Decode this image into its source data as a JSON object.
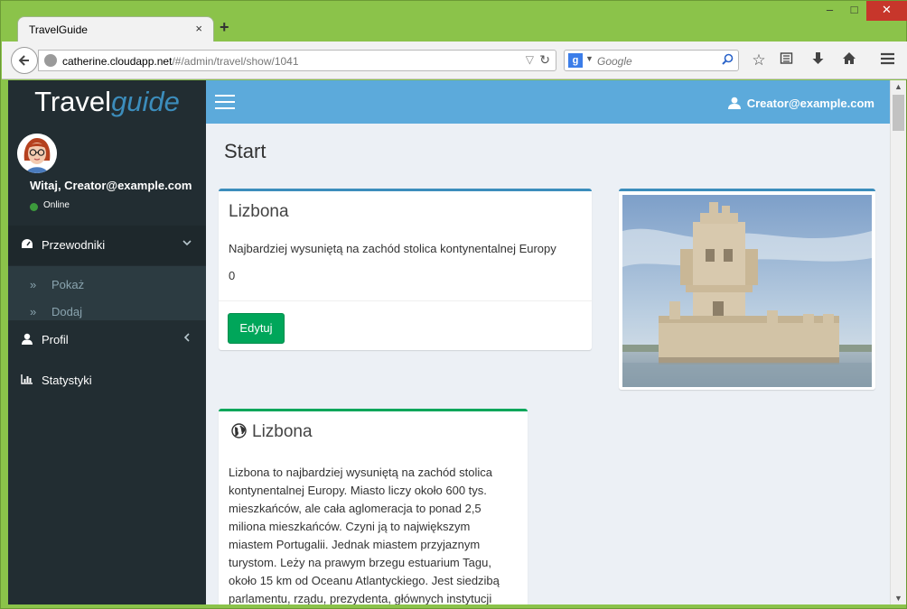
{
  "browser": {
    "tab_title": "TravelGuide",
    "tab_close": "×",
    "new_tab": "+",
    "window_min": "–",
    "window_max": "□",
    "window_close": "✕",
    "url_host": "catherine.cloudapp.net",
    "url_path": "/#/admin/travel/show/1041",
    "search_engine": "g",
    "search_placeholder": "Google"
  },
  "sidebar": {
    "logo_travel": "Travel",
    "logo_guide": "guide",
    "user_greeting": "Witaj, Creator@example.com",
    "status": "Online",
    "menu": [
      {
        "label": "Przewodniki",
        "icon": "dashboard-icon",
        "arrow": "⌄",
        "active": true
      },
      {
        "label": "Profil",
        "icon": "user-icon",
        "arrow": "‹",
        "active": false
      },
      {
        "label": "Statystyki",
        "icon": "bar-chart-icon",
        "arrow": "",
        "active": false
      }
    ],
    "submenu": [
      {
        "label": "Pokaż"
      },
      {
        "label": "Dodaj"
      }
    ]
  },
  "header": {
    "user_email": "Creator@example.com",
    "bg_color": "#5caadb"
  },
  "main": {
    "page_title": "Start",
    "card": {
      "title": "Lizbona",
      "description": "Najbardziej wysuniętą na zachód stolica kontynentalnej Europy",
      "number": "0",
      "edit_label": "Edytuj"
    },
    "detail": {
      "title": "Lizbona",
      "text": "Lizbona to najbardziej wysuniętą na zachód stolica kontynentalnej Europy. Miasto liczy około 600 tys. mieszkańców, ale cała aglomeracja to ponad 2,5 miliona mieszkańców. Czyni ją to największym miastem Portugalii. Jednak miastem przyjaznym turystom. Leży na prawym brzegu estuarium Tagu, około 15 km od Oceanu Atlantyckiego. Jest siedzibą parlamentu, rządu, prezydenta, głównych instytucji"
    }
  },
  "colors": {
    "sidebar_bg": "#222d32",
    "primary": "#3c8dbc",
    "success": "#00a65a"
  }
}
